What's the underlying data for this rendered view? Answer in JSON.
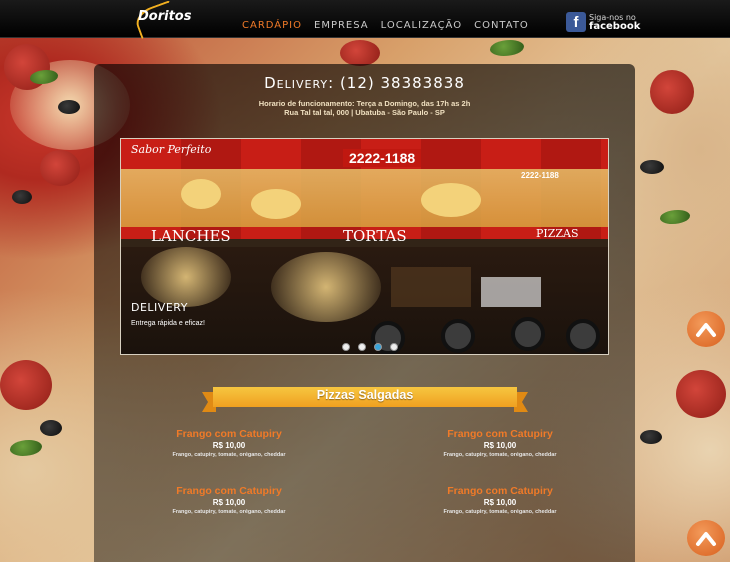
{
  "header": {
    "logo": "Doritos",
    "nav": [
      {
        "label": "Cardápio",
        "active": true
      },
      {
        "label": "Empresa",
        "active": false
      },
      {
        "label": "Localização",
        "active": false
      },
      {
        "label": "Contato",
        "active": false
      }
    ],
    "facebook": {
      "line1": "Siga-nos no",
      "line2": "facebook"
    }
  },
  "delivery": {
    "title": "Delivery: (12) 38383838",
    "hours": "Horario de funcionamento: Terça a Domingo, das 17h as 2h",
    "address": "Rua Tal tal tal, 000 | Ubatuba - São Paulo - SP"
  },
  "slider": {
    "image": {
      "brand": "Sabor Perfeito",
      "phone_main": "2222-1188",
      "phone_side": "2222-1188",
      "sign_left": "LANCHES",
      "sign_center": "TORTAS",
      "sign_right": "PIZZAS"
    },
    "caption_title": "DELIVERY",
    "caption_text": "Entrega rápida e eficaz!",
    "slides": 4,
    "active_slide": 3
  },
  "section": {
    "title": "Pizzas Salgadas"
  },
  "menu_items": [
    {
      "name": "Frango com Catupiry",
      "price": "R$ 10,00",
      "desc": "Frango, catupiry, tomate, orégano, cheddar"
    },
    {
      "name": "Frango com Catupiry",
      "price": "R$ 10,00",
      "desc": "Frango, catupiry, tomate, orégano, cheddar"
    },
    {
      "name": "Frango com Catupiry",
      "price": "R$ 10,00",
      "desc": "Frango, catupiry, tomate, orégano, cheddar"
    },
    {
      "name": "Frango com Catupiry",
      "price": "R$ 10,00",
      "desc": "Frango, catupiry, tomate, orégano, cheddar"
    }
  ],
  "colors": {
    "accent": "#f07a28",
    "ribbon": "#f6b830",
    "facebook": "#3b5998",
    "slide_active": "#3aa3d8"
  },
  "icons": [
    "facebook-icon",
    "chevron-up-icon"
  ]
}
